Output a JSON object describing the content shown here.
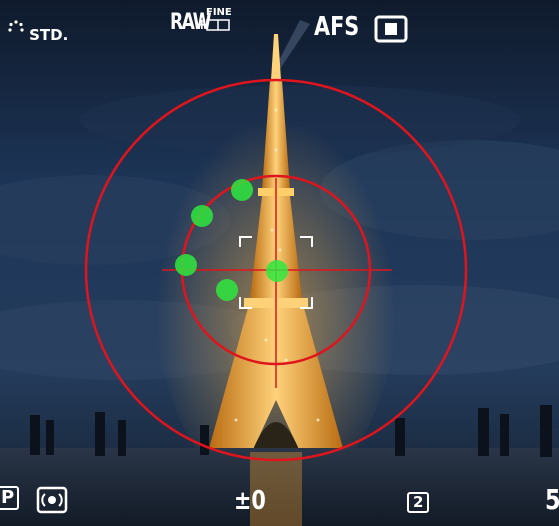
{
  "top_bar": {
    "picture_style": {
      "icon": "picture-style-icon",
      "label": "STD."
    },
    "image_quality": {
      "raw_label": "RAW",
      "plus": "+",
      "fine_label": "FINE",
      "icon": "image-quality-icon"
    },
    "af_mode": {
      "label": "AFS"
    },
    "drive_mode": {
      "icon": "single-shot-drive-icon"
    }
  },
  "bottom_bar": {
    "shooting_mode": {
      "label": "P"
    },
    "metering_mode": {
      "icon": "evaluative-metering-icon"
    },
    "exposure_compensation": {
      "label": "±0"
    },
    "shots_remaining": {
      "label": "2"
    },
    "battery_partial": {
      "label": "5"
    }
  },
  "overlay": {
    "reticle_color": "#e0141c",
    "af_point_color": "#2ee83f",
    "af_points_count": 5,
    "af_frame_color": "#ffffff"
  },
  "colors": {
    "sky": "#1f3556",
    "tower_glow": "#f6a430",
    "ground": "#202c3c"
  }
}
